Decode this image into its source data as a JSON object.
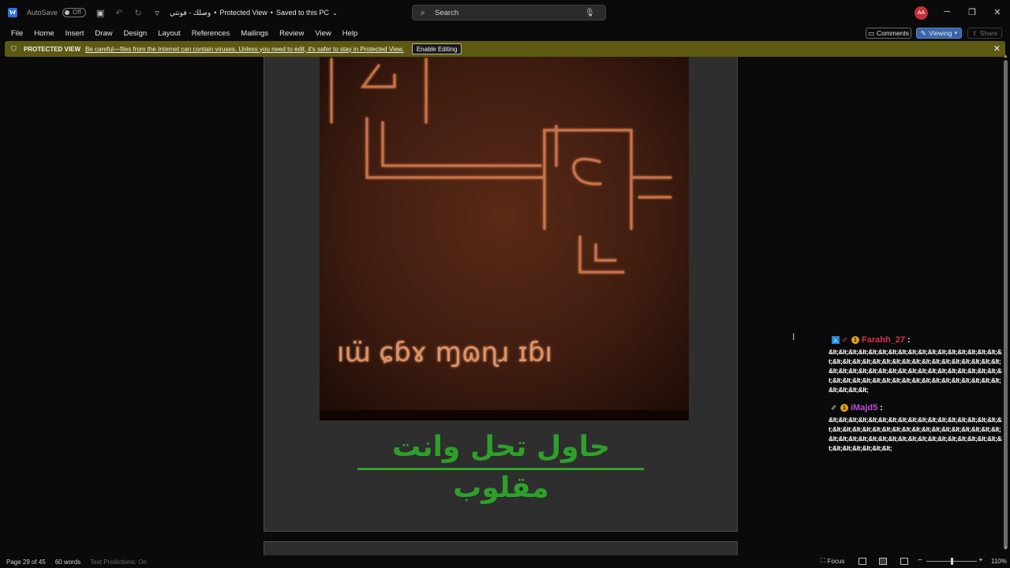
{
  "titlebar": {
    "autosave_label": "AutoSave",
    "autosave_state": "Off",
    "doc_name": "وصلك - فونتي",
    "separator": "•",
    "mode": "Protected View",
    "saved": "Saved to this PC",
    "search_placeholder": "Search",
    "avatar_initials": "AA"
  },
  "menu": {
    "items": [
      "File",
      "Home",
      "Insert",
      "Draw",
      "Design",
      "Layout",
      "References",
      "Mailings",
      "Review",
      "View",
      "Help"
    ],
    "comments": "Comments",
    "viewing": "Viewing",
    "share": "Share"
  },
  "protected_bar": {
    "title": "PROTECTED VIEW",
    "message": "Be careful—files from the Internet can contain viruses. Unless you need to edit, it's safer to stay in Protected View.",
    "enable_button": "Enable Editing"
  },
  "document": {
    "heading": "حاول تحل وانت مقلوب",
    "heading_color": "#2ea02a"
  },
  "chat": {
    "messages": [
      {
        "user": "Farahh_27",
        "user_color": "#d6324a",
        "text": "&lt;&lt;&lt;&lt;&lt;&lt;&lt;&lt;&lt;&lt;&lt;&lt;&lt;&lt;&lt;&lt;&lt;&lt;&lt;&lt;&lt;&lt;&lt;&lt;&lt;&lt;&lt;&lt;&lt;&lt;&lt;&lt;&lt;&lt;&lt;&lt;&lt;&lt;&lt;&lt;&lt;&lt;&lt;&lt;&lt;&lt;&lt;&lt;&lt;&lt;&lt;&lt;&lt;&lt;&lt;&lt;&lt;&lt;&lt;&lt;&lt;&lt;&lt;&lt;&lt;&lt;&lt;&lt;&lt;&lt;&lt;&lt;&lt;&lt;"
      },
      {
        "user": "iMajd5",
        "user_color": "#b34fd8",
        "text": "&lt;&lt;&lt;&lt;&lt;&lt;&lt;&lt;&lt;&lt;&lt;&lt;&lt;&lt;&lt;&lt;&lt;&lt;&lt;&lt;&lt;&lt;&lt;&lt;&lt;&lt;&lt;&lt;&lt;&lt;&lt;&lt;&lt;&lt;&lt;&lt;&lt;&lt;&lt;&lt;&lt;&lt;&lt;&lt;&lt;&lt;&lt;&lt;&lt;&lt;&lt;&lt;&lt;&lt;&lt;&lt;&lt;&lt;&lt;"
      }
    ]
  },
  "statusbar": {
    "page": "Page 29 of 45",
    "words": "60 words",
    "predictions": "Text Predictions: On",
    "focus": "Focus",
    "zoom": "110%"
  }
}
